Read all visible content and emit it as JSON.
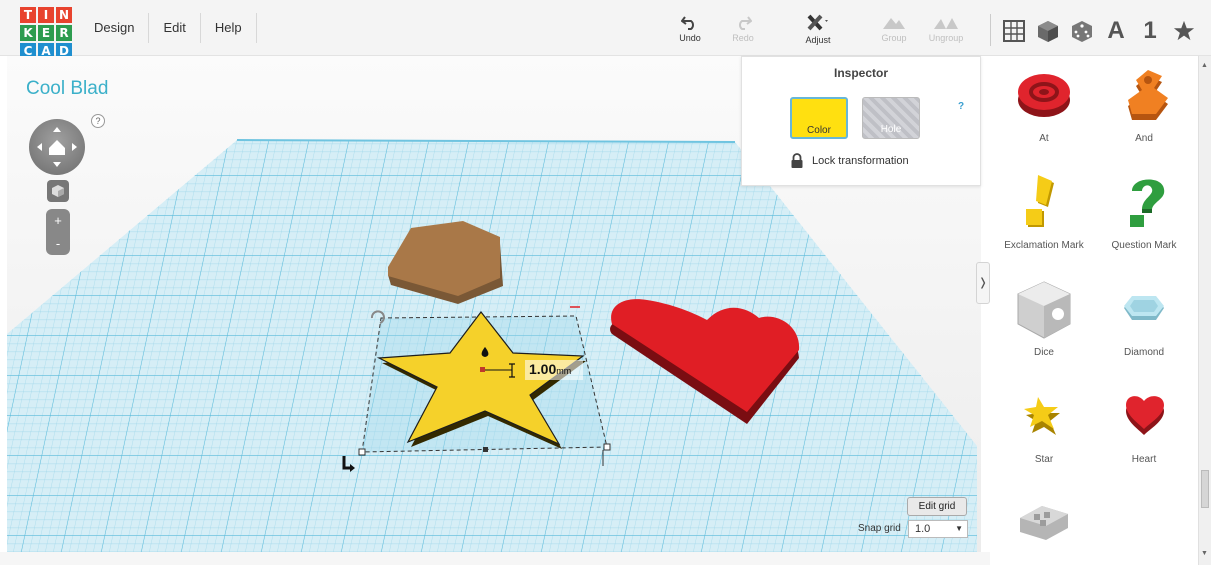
{
  "logo": {
    "letters": [
      "T",
      "I",
      "N",
      "K",
      "E",
      "R",
      "C",
      "A",
      "D"
    ],
    "colors": [
      "#e8432e",
      "#e8432e",
      "#e8432e",
      "#2d9c4f",
      "#2d9c4f",
      "#2d9c4f",
      "#1f8fcf",
      "#1f8fcf",
      "#1f8fcf"
    ]
  },
  "menu": {
    "items": [
      "Design",
      "Edit",
      "Help"
    ]
  },
  "toolbar": {
    "undo": "Undo",
    "redo": "Redo",
    "adjust": "Adjust",
    "group": "Group",
    "ungroup": "Ungroup"
  },
  "view_tools": {
    "grid_icon": "grid-icon",
    "box_icon": "box-icon",
    "dice_icon": "dice-icon",
    "text_label": "A",
    "number_label": "1",
    "star_icon": "star-icon"
  },
  "design": {
    "title": "Cool Blad"
  },
  "workplane": {
    "dimension_value": "1.00",
    "dimension_unit": "mm",
    "edit_grid": "Edit grid",
    "snap_grid_label": "Snap grid",
    "snap_grid_value": "1.0"
  },
  "inspector": {
    "title": "Inspector",
    "color_label": "Color",
    "hole_label": "Hole",
    "help": "?",
    "lock_label": "Lock transformation",
    "selected_color": "#ffe010"
  },
  "nav_help": "?",
  "shapes": [
    {
      "label": "At",
      "color": "#d9232e"
    },
    {
      "label": "And",
      "color": "#ef7d1a"
    },
    {
      "label": "Exclamation Mark",
      "color": "#f1c40f"
    },
    {
      "label": "Question Mark",
      "color": "#2e9d3e"
    },
    {
      "label": "Dice",
      "color": "#dcdcdc"
    },
    {
      "label": "Diamond",
      "color": "#a7dbe8"
    },
    {
      "label": "Star",
      "color": "#f1c40f"
    },
    {
      "label": "Heart",
      "color": "#d9232e"
    },
    {
      "label": "",
      "color": "#c8c8c8"
    }
  ]
}
